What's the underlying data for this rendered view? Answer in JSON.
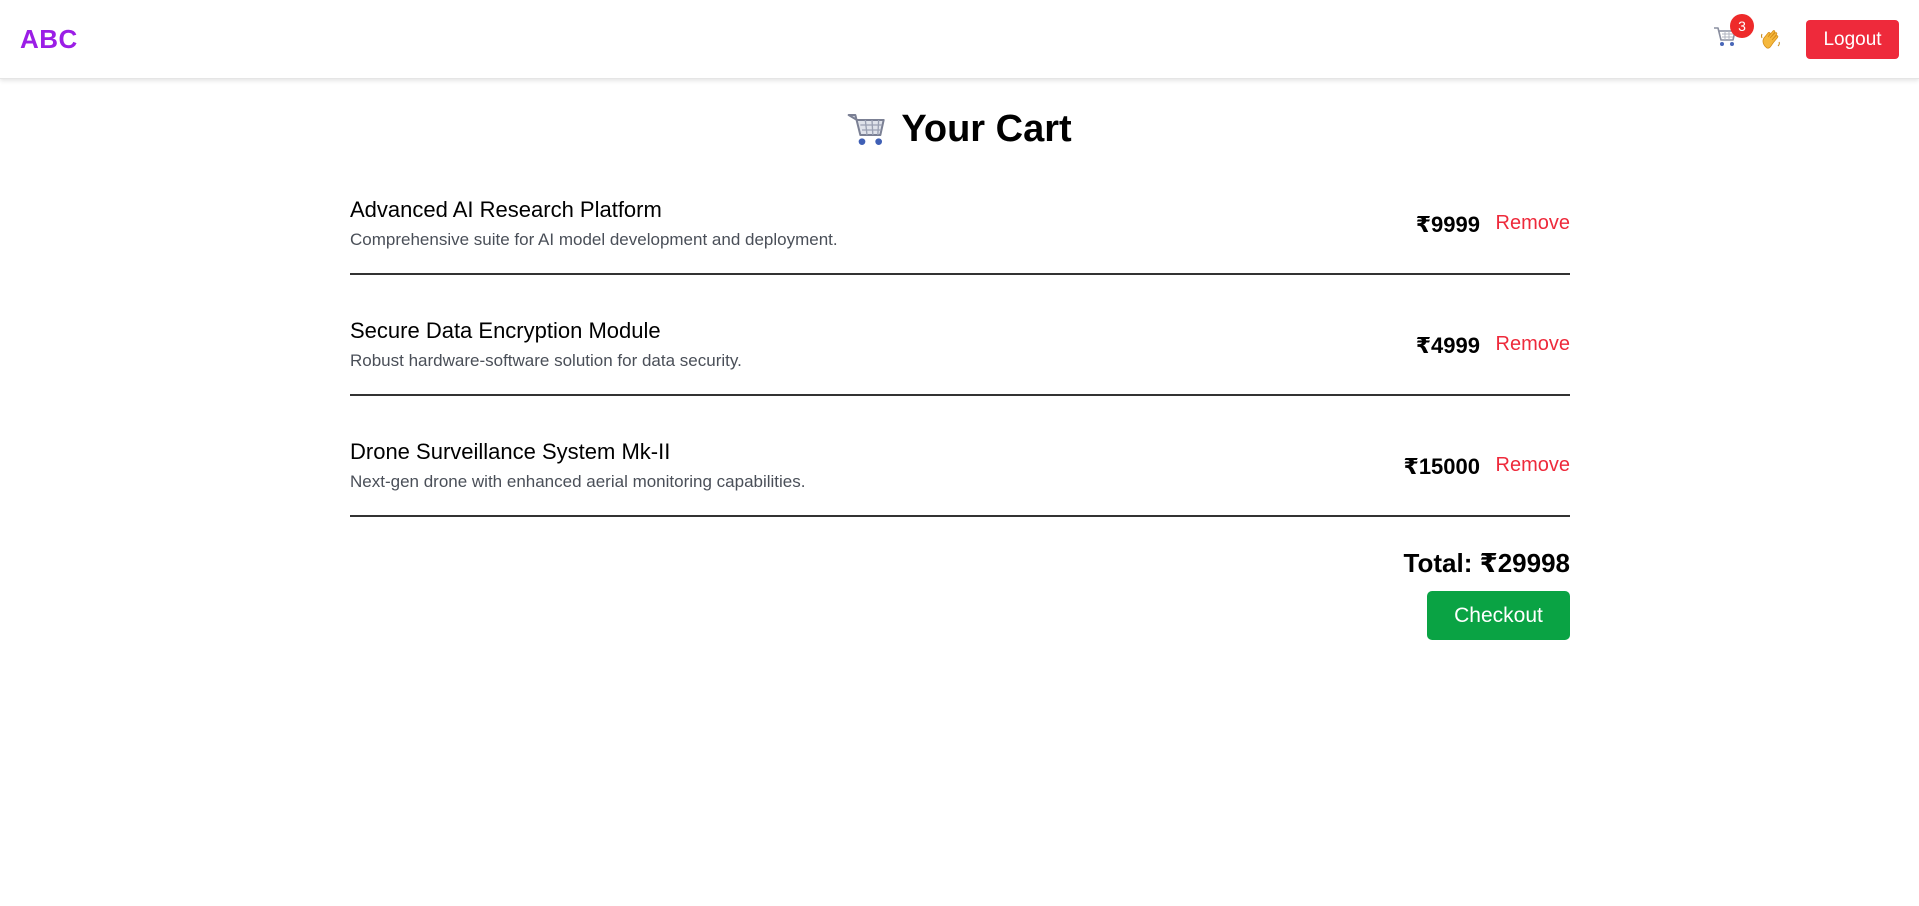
{
  "nav": {
    "brand": "ABC",
    "cart_count": "3",
    "logout_label": "Logout",
    "cart_icon": "cart-icon",
    "wave_icon": "waving-hand-icon"
  },
  "page": {
    "title": "Your Cart",
    "title_icon": "cart-icon"
  },
  "cart": {
    "items": [
      {
        "name": "Advanced AI Research Platform",
        "description": "Comprehensive suite for AI model development and deployment.",
        "price": "₹9999",
        "remove_label": "Remove"
      },
      {
        "name": "Secure Data Encryption Module",
        "description": "Robust hardware-software solution for data security.",
        "price": "₹4999",
        "remove_label": "Remove"
      },
      {
        "name": "Drone Surveillance System Mk-II",
        "description": "Next-gen drone with enhanced aerial monitoring capabilities.",
        "price": "₹15000",
        "remove_label": "Remove"
      }
    ],
    "total": "Total: ₹29998",
    "checkout_label": "Checkout"
  },
  "colors": {
    "brand": "#9b1ee6",
    "danger": "#ee2a3b",
    "success": "#0aa344"
  }
}
